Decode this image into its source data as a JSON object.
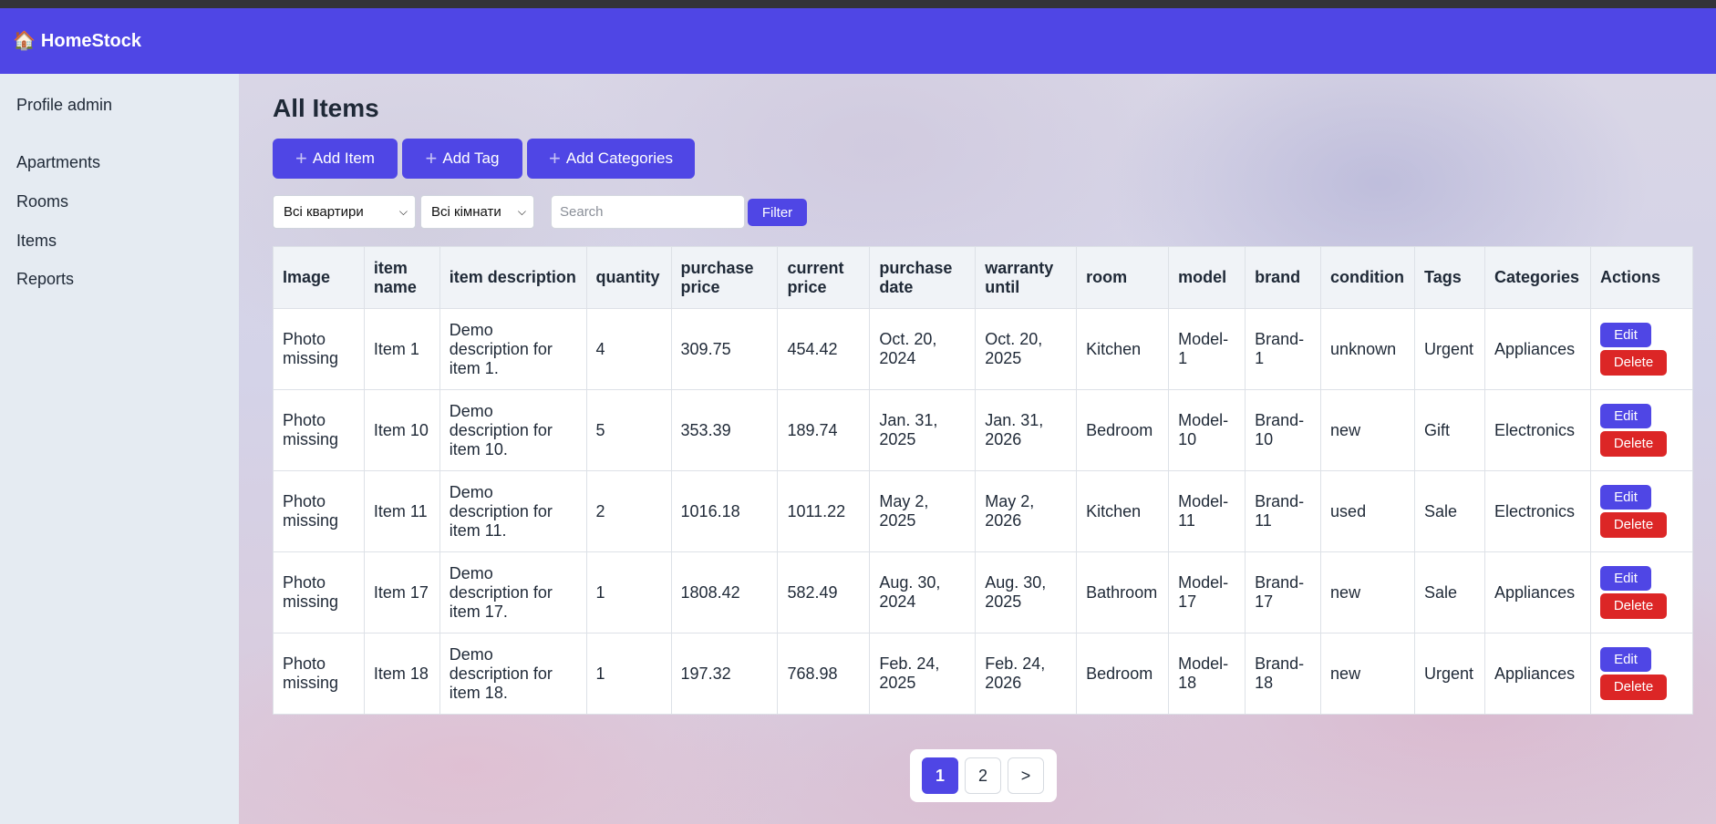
{
  "app": {
    "name": "HomeStock",
    "logo_glyph": "🏠"
  },
  "sidebar": {
    "profile": "Profile admin",
    "items": [
      {
        "label": "Apartments"
      },
      {
        "label": "Rooms"
      },
      {
        "label": "Items"
      },
      {
        "label": "Reports"
      }
    ]
  },
  "main": {
    "title": "All Items",
    "buttons": {
      "add_item": "Add Item",
      "add_tag": "Add Tag",
      "add_categories": "Add Categories",
      "plus_glyph": "+"
    },
    "filters": {
      "apartment_select": "Всі квартири",
      "room_select": "Всі кімнати",
      "search_placeholder": "Search",
      "filter_button": "Filter"
    }
  },
  "table": {
    "headers": [
      "Image",
      "item name",
      "item description",
      "quantity",
      "purchase price",
      "current price",
      "purchase date",
      "warranty until",
      "room",
      "model",
      "brand",
      "condition",
      "Tags",
      "Categories",
      "Actions"
    ],
    "rows": [
      {
        "image": "Photo missing",
        "name": "Item 1",
        "description": "Demo description for item 1.",
        "quantity": "4",
        "purchase_price": "309.75",
        "current_price": "454.42",
        "purchase_date": "Oct. 20, 2024",
        "warranty_until": "Oct. 20, 2025",
        "room": "Kitchen",
        "model": "Model-1",
        "brand": "Brand-1",
        "condition": "unknown",
        "tags": "Urgent",
        "categories": "Appliances"
      },
      {
        "image": "Photo missing",
        "name": "Item 10",
        "description": "Demo description for item 10.",
        "quantity": "5",
        "purchase_price": "353.39",
        "current_price": "189.74",
        "purchase_date": "Jan. 31, 2025",
        "warranty_until": "Jan. 31, 2026",
        "room": "Bedroom",
        "model": "Model-10",
        "brand": "Brand-10",
        "condition": "new",
        "tags": "Gift",
        "categories": "Electronics"
      },
      {
        "image": "Photo missing",
        "name": "Item 11",
        "description": "Demo description for item 11.",
        "quantity": "2",
        "purchase_price": "1016.18",
        "current_price": "1011.22",
        "purchase_date": "May 2, 2025",
        "warranty_until": "May 2, 2026",
        "room": "Kitchen",
        "model": "Model-11",
        "brand": "Brand-11",
        "condition": "used",
        "tags": "Sale",
        "categories": "Electronics"
      },
      {
        "image": "Photo missing",
        "name": "Item 17",
        "description": "Demo description for item 17.",
        "quantity": "1",
        "purchase_price": "1808.42",
        "current_price": "582.49",
        "purchase_date": "Aug. 30, 2024",
        "warranty_until": "Aug. 30, 2025",
        "room": "Bathroom",
        "model": "Model-17",
        "brand": "Brand-17",
        "condition": "new",
        "tags": "Sale",
        "categories": "Appliances"
      },
      {
        "image": "Photo missing",
        "name": "Item 18",
        "description": "Demo description for item 18.",
        "quantity": "1",
        "purchase_price": "197.32",
        "current_price": "768.98",
        "purchase_date": "Feb. 24, 2025",
        "warranty_until": "Feb. 24, 2026",
        "room": "Bedroom",
        "model": "Model-18",
        "brand": "Brand-18",
        "condition": "new",
        "tags": "Urgent",
        "categories": "Appliances"
      }
    ],
    "actions": {
      "edit": "Edit",
      "delete": "Delete"
    }
  },
  "pagination": {
    "pages": [
      "1",
      "2"
    ],
    "current": "1",
    "next": ">"
  },
  "colors": {
    "accent": "#4f46e5",
    "danger": "#dc2626",
    "sidebar_bg": "#e5ebf2"
  }
}
